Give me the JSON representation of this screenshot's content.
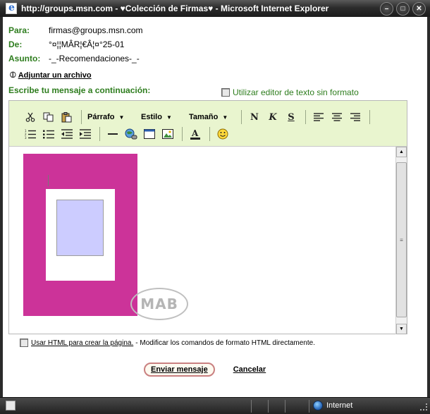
{
  "window": {
    "title": "http://groups.msn.com - ♥Colección de Firmas♥ - Microsoft Internet Explorer",
    "minimize": "–",
    "maximize": "□",
    "close": "✕"
  },
  "header": {
    "to_label": "Para:",
    "to_value": "firmas@groups.msn.com",
    "from_label": "De:",
    "from_value": "°¤¦¦MÂR¦€Â¦¤°25-01",
    "subject_label": "Asunto:",
    "subject_value": "-_-Recomendaciones-_-"
  },
  "attach": {
    "label": "Adjuntar un archivo",
    "icon": "paperclip-icon"
  },
  "compose": {
    "label": "Escribe tu mensaje a continuación:",
    "plain_text_toggle": "Utilizar editor de texto sin formato",
    "plain_text_checked": false
  },
  "toolbar": {
    "paragraph": "Párrafo",
    "style": "Estilo",
    "size": "Tamaño",
    "bold": "N",
    "italic": "K",
    "underline": "S",
    "icons_row1": [
      "cut-icon",
      "copy-icon",
      "paste-icon",
      "align-left-icon",
      "align-center-icon",
      "align-right-icon"
    ],
    "icons_row2": [
      "numbered-list-icon",
      "bullet-list-icon",
      "outdent-icon",
      "indent-icon",
      "horizontal-rule-icon",
      "link-icon",
      "table-icon",
      "image-icon",
      "text-color-icon",
      "emoticon-icon"
    ]
  },
  "editor": {
    "watermark": "MAB",
    "colors": {
      "pink": "#cc3399",
      "lavender": "#ccccff",
      "toolbar_bg": "#e9f5cf",
      "label_green": "#2e7d1e"
    }
  },
  "footer": {
    "html_link": "Usar HTML para crear la página.",
    "html_desc": "- Modificar los comandos de formato HTML directamente.",
    "send_button": "Enviar mensaje",
    "cancel_link": "Cancelar"
  },
  "status": {
    "zone": "Internet"
  }
}
